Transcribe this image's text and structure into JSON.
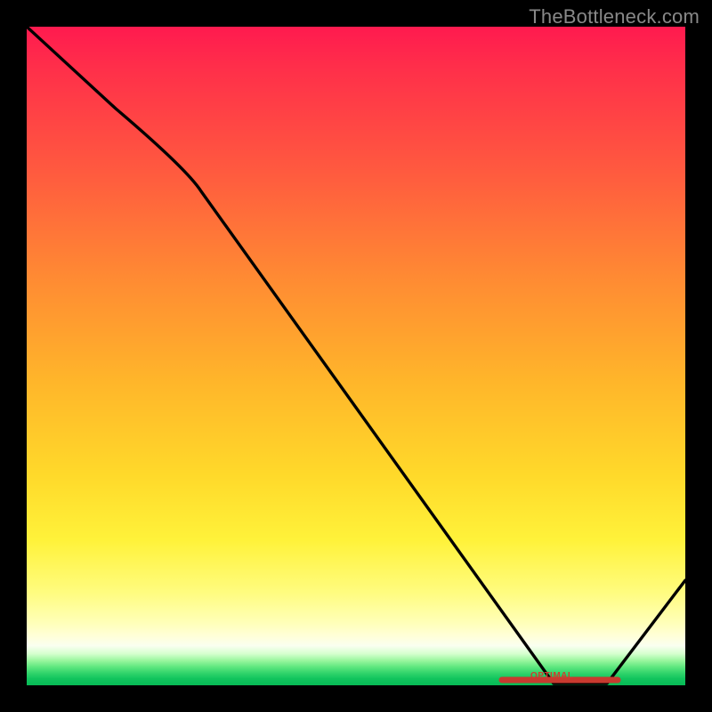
{
  "watermark": "TheBottleneck.com",
  "optimal_label": "OPTIMAL",
  "colors": {
    "curve": "#000000",
    "optimal_line": "#c83a2f",
    "optimal_text": "#d23a2f",
    "gradient_top": "#ff1a4f",
    "gradient_bottom": "#07ba55",
    "background": "#000000"
  },
  "chart_data": {
    "type": "line",
    "title": "",
    "xlabel": "",
    "ylabel": "",
    "xlim": [
      0,
      100
    ],
    "ylim": [
      0,
      100
    ],
    "x": [
      0,
      25,
      80,
      88,
      100
    ],
    "values": [
      100,
      80,
      0,
      0,
      16
    ],
    "optimal_range_x": [
      72,
      90
    ],
    "note": "Bottleneck curve: high on left, descends, flat near zero around x≈80–88 (optimal), then rises on right."
  }
}
